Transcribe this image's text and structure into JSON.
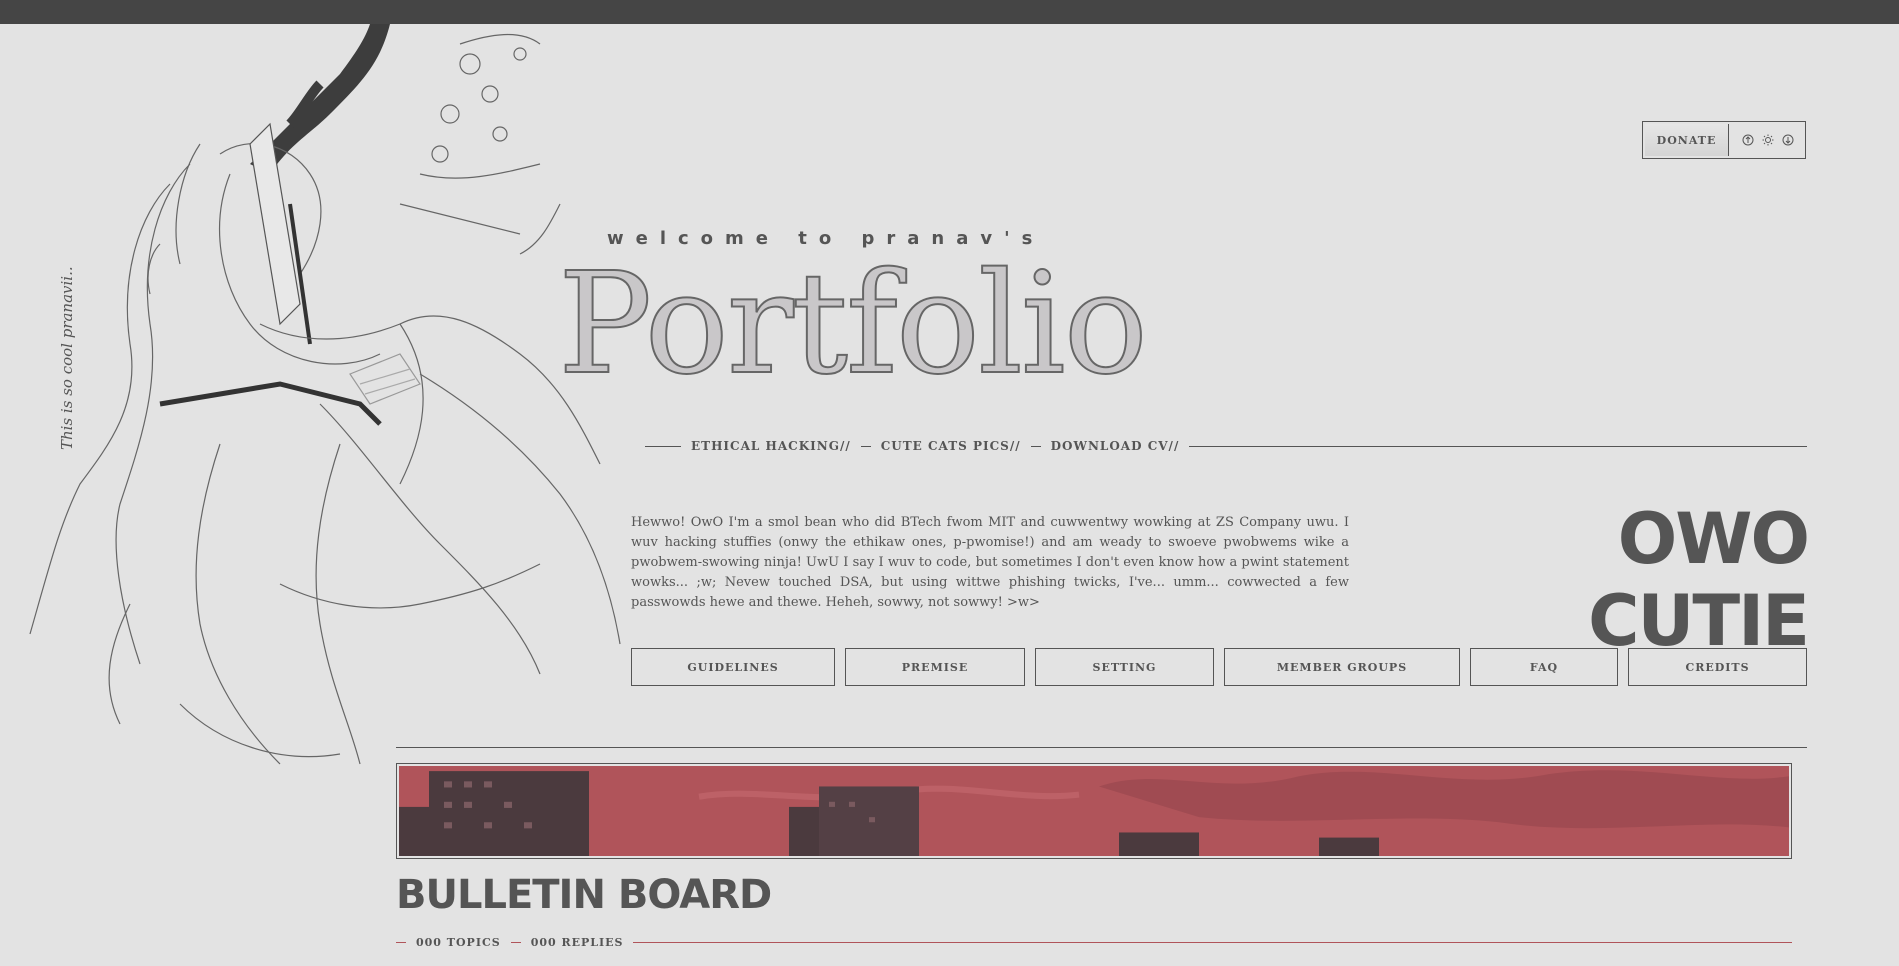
{
  "header": {
    "donate_label": "DONATE",
    "icons": [
      "arrow-up-circle-icon",
      "sun-icon",
      "arrow-down-circle-icon"
    ]
  },
  "side_caption": "This is so cool pranavii..",
  "hero": {
    "welcome": "welcome to pranav's",
    "title": "Portfolio"
  },
  "nav": {
    "items": [
      "ETHICAL HACKING//",
      "CUTE CATS PICS//",
      "DOWNLOAD CV//"
    ]
  },
  "intro": {
    "text": "Hewwo! OwO I'm a smol bean who did BTech fwom MIT and cuwwentwy wowking at ZS Company uwu. I wuv hacking stuffies (onwy the ethikaw ones, p-pwomise!) and am weady to swoeve pwobwems wike a pwobwem-swowing ninja! UwU I say I wuv to code, but sometimes I don't even know how a pwint statement wowks... ;w; Nevew touched DSA, but using wittwe phishing twicks, I've... umm... cowwected a few passwowds hewe and thewe. Heheh, sowwy, not sowwy! >w>",
    "tagline": "OWO CUTIE"
  },
  "buttons": [
    "GUIDELINES",
    "PREMISE",
    "SETTING",
    "MEMBER GROUPS",
    "FAQ",
    "CREDITS"
  ],
  "bulletin": {
    "title": "BULLETIN BOARD",
    "topics": "000 TOPICS",
    "replies": "000 REPLIES"
  },
  "colors": {
    "background": "#e3e3e3",
    "text": "#555555",
    "accent": "#b0545a",
    "topbar": "#454545"
  }
}
